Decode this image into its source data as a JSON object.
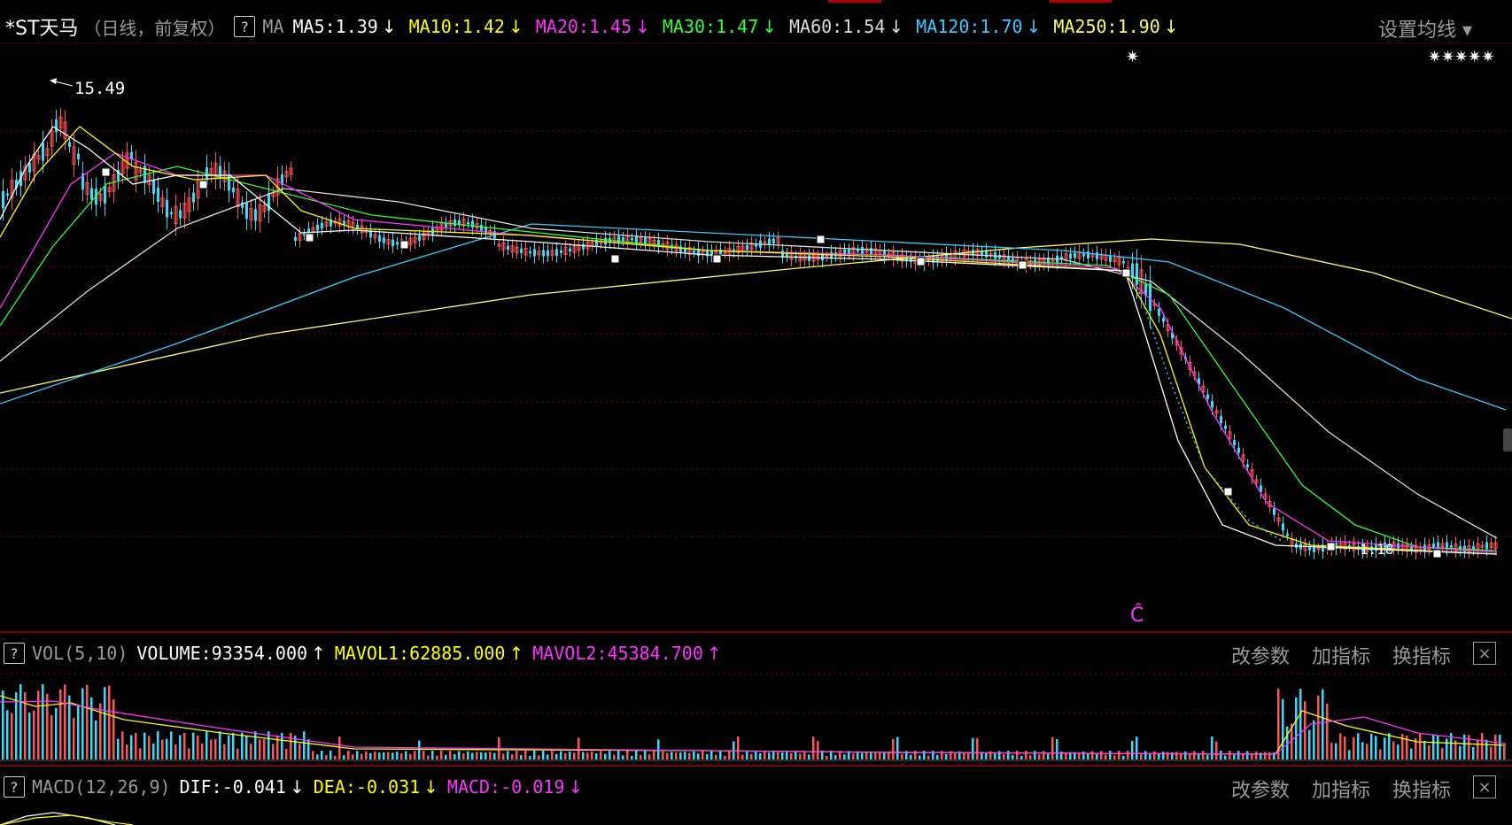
{
  "header": {
    "title": "*ST天马",
    "subtitle": "（日线，前复权）",
    "help": "?",
    "indicator": "MA",
    "ma": [
      {
        "label": "MA5:1.39",
        "color": "#ffffff",
        "arrow": "↓"
      },
      {
        "label": "MA10:1.42",
        "color": "#ffff00",
        "arrow": "↓"
      },
      {
        "label": "MA20:1.45",
        "color": "#ff33ff",
        "arrow": "↓"
      },
      {
        "label": "MA30:1.47",
        "color": "#33ff33",
        "arrow": "↓"
      },
      {
        "label": "MA60:1.54",
        "color": "#dddddd",
        "arrow": "↓"
      },
      {
        "label": "MA120:1.70",
        "color": "#33ccff",
        "arrow": "↓"
      },
      {
        "label": "MA250:1.90",
        "color": "#ffff66",
        "arrow": "↓"
      }
    ],
    "settings": "设置均线 ▾"
  },
  "price_panel": {
    "high_label": "15.49",
    "low_label": "1.18",
    "c_marker": "Ĉ",
    "star_marker": "✷",
    "right_marker": "✷✷✷✷✷"
  },
  "vol_panel": {
    "help": "?",
    "name": "VOL(5,10)",
    "volume": {
      "label": "VOLUME:93354.000",
      "color": "#ffffff",
      "arrow": "↑"
    },
    "mavol1": {
      "label": "MAVOL1:62885.000",
      "color": "#ffff00",
      "arrow": "↑"
    },
    "mavol2": {
      "label": "MAVOL2:45384.700",
      "color": "#ff33ff",
      "arrow": "↑"
    },
    "buttons": [
      "改参数",
      "加指标",
      "换指标"
    ],
    "close": "×"
  },
  "macd_panel": {
    "help": "?",
    "name": "MACD(12,26,9)",
    "dif": {
      "label": "DIF:-0.041",
      "color": "#ffffff",
      "arrow": "↓"
    },
    "dea": {
      "label": "DEA:-0.031",
      "color": "#ffff00",
      "arrow": "↓"
    },
    "macd": {
      "label": "MACD:-0.019",
      "color": "#ff33ff",
      "arrow": "↓"
    },
    "buttons": [
      "改参数",
      "加指标",
      "换指标"
    ],
    "close": "×"
  },
  "colors": {
    "up": "#ff5555",
    "down": "#33ddff",
    "grid": "#7a0000",
    "ma5": "#ffffff",
    "ma10": "#ffff00",
    "ma20": "#ff33ff",
    "ma30": "#33ff33",
    "ma60": "#dddddd",
    "ma120": "#33ccff",
    "ma250": "#ffff66"
  }
}
